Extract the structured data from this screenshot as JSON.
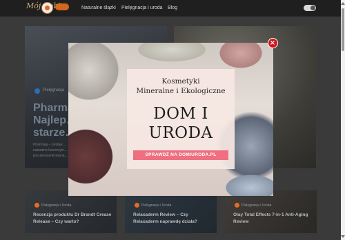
{
  "navbar": {
    "logo_text": "Mój Kobi",
    "links": [
      "Naturalne ślązki",
      "Pielęgnacja i uroda",
      "Blog"
    ]
  },
  "hero": {
    "category": "Pielęgnacja",
    "title": "Pharma… Najlep… starze…",
    "excerpt": "Pharmaja – zestaw… naturalne kosmetyki… jest skoncentrowana…"
  },
  "cards": [
    {
      "category": "Pielęgnacja i Uroda",
      "title": "Recenzja produktu Dr Brandt Crease Release – Czy warto?"
    },
    {
      "category": "Pielęgnacja i Uroda",
      "title": "Relaxaderm Review – Czy Relaxaderm naprawdę działa?"
    },
    {
      "category": "Pielęgnacja i Uroda",
      "title": "Olay Total Effects 7-in-1 Anti-Aging Review"
    }
  ],
  "modal": {
    "line1": "Kosmetyki",
    "line2": "Mineralne i Ekologiczne",
    "big1": "DOM I",
    "big2": "URODA",
    "cta": "SPRAWDŹ NA DOMIURODA.PL",
    "close_icon": "close-icon"
  },
  "colors": {
    "accent": "#e56d1f",
    "cta": "#ef6f80",
    "close": "#d1161d"
  }
}
